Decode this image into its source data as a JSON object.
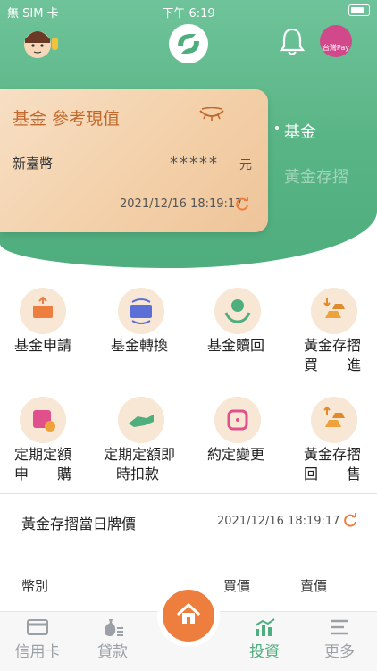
{
  "status_bar": {
    "carrier": "無 SIM 卡",
    "time": "下午 6:19"
  },
  "header": {
    "pay_label": "台灣Pay"
  },
  "card": {
    "title": "基金 參考現值",
    "currency": "新臺幣",
    "masked_value": "*****",
    "unit": "元",
    "timestamp": "2021/12/16 18:19:17"
  },
  "side_tabs": [
    {
      "label": "基金",
      "active": true
    },
    {
      "label": "黃金存摺",
      "active": false
    }
  ],
  "functions": [
    {
      "label": "基金申請",
      "icon": "fund-apply-icon"
    },
    {
      "label": "基金轉換",
      "icon": "fund-switch-icon"
    },
    {
      "label": "基金贖回",
      "icon": "fund-redeem-icon"
    },
    {
      "label_lines": [
        "黃金存摺",
        "買　　進"
      ],
      "icon": "gold-buy-icon"
    },
    {
      "label_lines": [
        "定期定額",
        "申　　購"
      ],
      "icon": "regular-subscribe-icon"
    },
    {
      "label_lines": [
        "定期定額即",
        "時扣款"
      ],
      "icon": "instant-debit-icon"
    },
    {
      "label": "約定變更",
      "icon": "agreement-change-icon"
    },
    {
      "label_lines": [
        "黃金存摺",
        "回　　售"
      ],
      "icon": "gold-sell-icon"
    }
  ],
  "gold_price": {
    "title": "黃金存摺當日牌價",
    "timestamp": "2021/12/16 18:19:17",
    "columns": [
      "幣別",
      "買價",
      "賣價"
    ]
  },
  "tabbar": [
    {
      "label": "信用卡",
      "icon": "credit-card-icon",
      "active": false
    },
    {
      "label": "貸款",
      "icon": "loan-icon",
      "active": false
    },
    {
      "label": "投資",
      "icon": "invest-icon",
      "active": true
    },
    {
      "label": "更多",
      "icon": "menu-icon",
      "active": false
    }
  ],
  "colors": {
    "brand_green": "#4fae7e",
    "accent_orange": "#ee7e3d",
    "card_title": "#c2682b"
  }
}
